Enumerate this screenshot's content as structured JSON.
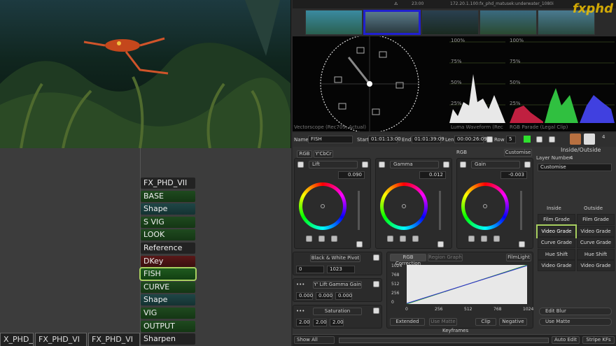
{
  "topbar": {
    "path": "172.20.1.100:fx_phd_matusek:underwater_1080i",
    "clock": "23:00"
  },
  "logo": "fxphd",
  "scopes": {
    "vectorscope_label": "Vectorscope (Rec709, Actual)",
    "waveform_label": "Luma Waveform (Rec",
    "parade_label": "RGB Parade (Legal Clip)",
    "pct": [
      "100%",
      "75%",
      "50%",
      "25%"
    ]
  },
  "nodes": [
    {
      "label": "FX_PHD_VII",
      "style": "n-dark"
    },
    {
      "label": "BASE",
      "style": "n-green"
    },
    {
      "label": "Shape",
      "style": "n-teal"
    },
    {
      "label": "S VIG",
      "style": "n-green"
    },
    {
      "label": "LOOK",
      "style": "n-green"
    },
    {
      "label": "Reference",
      "style": "n-dark"
    },
    {
      "label": "DKey",
      "style": "n-red"
    },
    {
      "label": "FISH",
      "style": "n-sel"
    },
    {
      "label": "CURVE",
      "style": "n-green"
    },
    {
      "label": "Shape",
      "style": "n-teal"
    },
    {
      "label": "VIG",
      "style": "n-green"
    },
    {
      "label": "OUTPUT",
      "style": "n-green"
    },
    {
      "label": "Sharpen",
      "style": "n-dark"
    }
  ],
  "tabs": [
    "X_PHD_'",
    "FX_PHD_VI",
    "FX_PHD_VI"
  ],
  "namebar": {
    "name_label": "Name",
    "name": "FISH",
    "start_label": "Start",
    "start": "01:01:13:00",
    "end_label": "End",
    "end": "01:01:39:09",
    "len_label": "Len",
    "len": "00:00:26:09",
    "row_label": "Row",
    "row": "5",
    "count": "4"
  },
  "grade": {
    "mode_tabs": [
      "RGB",
      "Y'CbCr"
    ],
    "rgb_label": "RGB",
    "customise": "Customise",
    "wheels": [
      {
        "name": "Lift",
        "value": "0.090"
      },
      {
        "name": "Gamma",
        "value": "0.012"
      },
      {
        "name": "Gain",
        "value": "-0.003"
      }
    ],
    "inside_outside": {
      "title": "Inside/Outside",
      "layer_label": "Layer Number:",
      "layer": "4",
      "customise": "Customise",
      "inside": "Inside",
      "outside": "Outside",
      "rows": [
        [
          "Film Grade",
          "Film Grade"
        ],
        [
          "Video Grade",
          "Video Grade"
        ],
        [
          "Curve Grade",
          "Curve Grade"
        ],
        [
          "Hue Shift",
          "Hue Shift"
        ],
        [
          "Video Grade",
          "Video Grade"
        ]
      ],
      "edit_blur": "Edit Blur",
      "use_matte": "Use Matte"
    },
    "pivot": {
      "title": "Black & White Pivot",
      "low": "0",
      "high": "1023"
    },
    "lgg": {
      "title": "Y' Lift Gamma Gain",
      "v1": "0.000",
      "v2": "0.000",
      "v3": "0.000"
    },
    "sat": {
      "title": "Saturation",
      "v1": "2.00",
      "v2": "2.00",
      "v3": "2.00"
    },
    "curve_tabs": [
      "RGB Correction",
      "Region Graph"
    ],
    "filmlight": "FilmLight",
    "curve_y": [
      "1024",
      "768",
      "512",
      "256",
      "0"
    ],
    "curve_x": [
      "0",
      "256",
      "512",
      "768",
      "1024"
    ],
    "curve_buttons": [
      "Extended",
      "Use Matte",
      "Clip",
      "Negative"
    ],
    "keyframes": "Keyframes"
  },
  "bottombar": {
    "show": "Show All",
    "auto_edit": "Auto Edit",
    "stripe": "Stripe KFs"
  }
}
